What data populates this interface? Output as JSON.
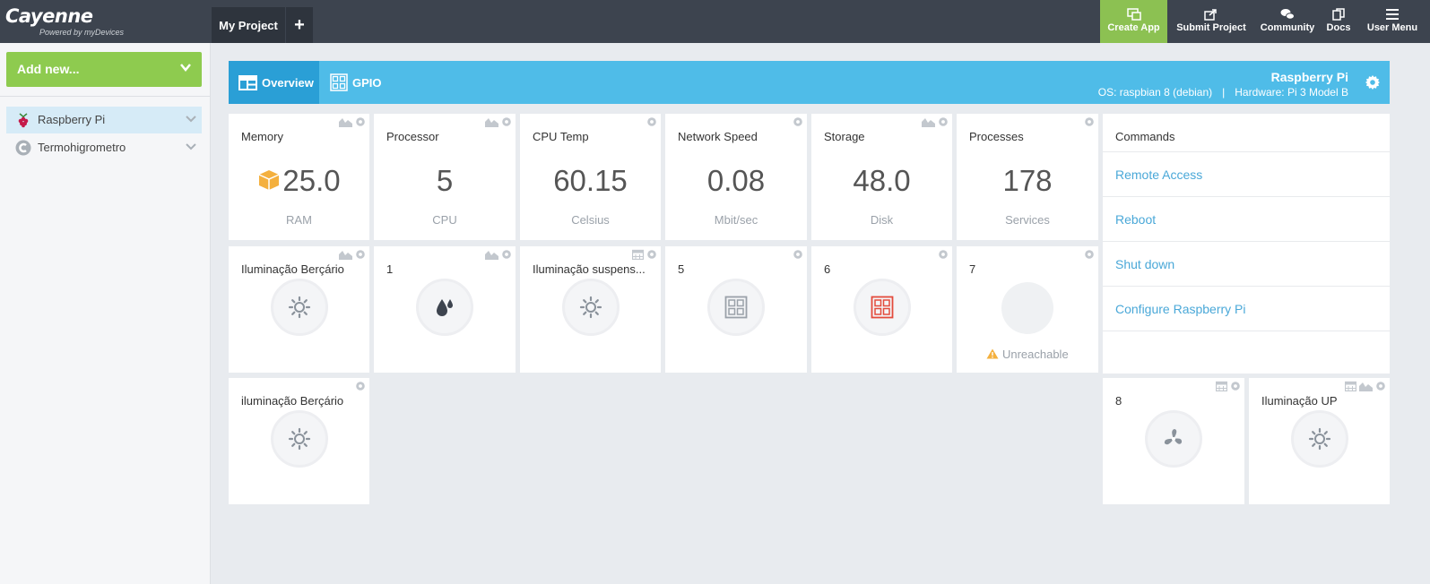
{
  "topbar": {
    "logo": "Cayenne",
    "logo_sub": "Powered by myDevices",
    "project": "My Project",
    "add_project": "+",
    "nav": {
      "create_app": "Create App",
      "submit_project": "Submit Project",
      "community": "Community",
      "docs": "Docs",
      "user_menu": "User Menu"
    }
  },
  "sidebar": {
    "add_new": "Add new...",
    "devices": [
      {
        "label": "Raspberry Pi",
        "icon": "raspberry-pi-icon"
      },
      {
        "label": "Termohigrometro",
        "icon": "cayenne-c-icon"
      }
    ]
  },
  "header": {
    "tabs": {
      "overview": "Overview",
      "gpio": "GPIO"
    },
    "device_name": "Raspberry Pi",
    "os": "OS: raspbian 8 (debian)",
    "separator": "|",
    "hardware": "Hardware: Pi 3 Model B"
  },
  "widgets": {
    "memory": {
      "title": "Memory",
      "value": "25.0",
      "unit": "RAM"
    },
    "processor": {
      "title": "Processor",
      "value": "5",
      "unit": "CPU"
    },
    "cpu_temp": {
      "title": "CPU Temp",
      "value": "60.15",
      "unit": "Celsius"
    },
    "network": {
      "title": "Network Speed",
      "value": "0.08",
      "unit": "Mbit/sec"
    },
    "storage": {
      "title": "Storage",
      "value": "48.0",
      "unit": "Disk"
    },
    "processes": {
      "title": "Processes",
      "value": "178",
      "unit": "Services"
    },
    "w_iluminacao_bercario": {
      "title": "Iluminação Berçário"
    },
    "w_1": {
      "title": "1"
    },
    "w_iluminacao_suspensa": {
      "title": "Iluminação suspens..."
    },
    "w_5": {
      "title": "5"
    },
    "w_6": {
      "title": "6"
    },
    "w_7": {
      "title": "7",
      "status": "Unreachable"
    },
    "w_iluminacao_bercario2": {
      "title": "iluminação Berçário"
    },
    "w_8": {
      "title": "8"
    },
    "w_iluminacao_up": {
      "title": "Iluminação UP"
    }
  },
  "commands": {
    "title": "Commands",
    "items": [
      "Remote Access",
      "Reboot",
      "Shut down",
      "Configure Raspberry Pi"
    ]
  },
  "colors": {
    "topbar": "#3d444f",
    "accent_green": "#8ecb4f",
    "header_blue": "#4fbce8",
    "link_blue": "#4aa8d8"
  }
}
